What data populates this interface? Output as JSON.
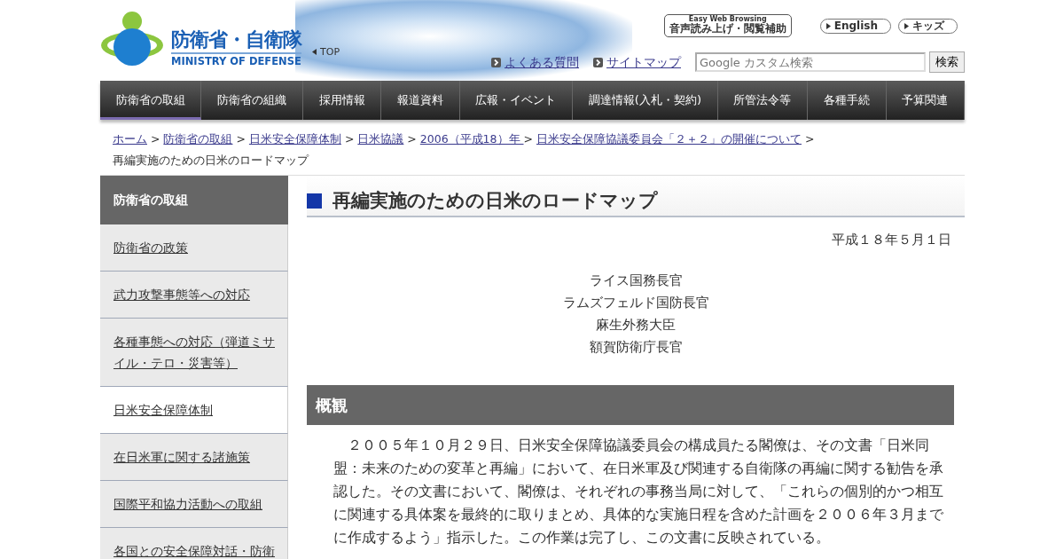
{
  "header": {
    "logo_title": "防衛省・自衛隊",
    "logo_subtitle": "MINISTRY OF DEFENSE",
    "top_link": "TOP",
    "accessibility": {
      "caption": "Easy Web Browsing",
      "label": "音声読み上げ・閲覧補助"
    },
    "language_links": [
      "English",
      "キッズ"
    ],
    "links": [
      "よくある質問",
      "サイトマップ"
    ],
    "search": {
      "placeholder": "Google カスタム検索",
      "button": "検索"
    }
  },
  "nav": [
    {
      "label": "防衛省の取組",
      "selected": true
    },
    {
      "label": "防衛省の組織",
      "selected": false
    },
    {
      "label": "採用情報",
      "selected": false
    },
    {
      "label": "報道資料",
      "selected": false
    },
    {
      "label": "広報・イベント",
      "selected": false
    },
    {
      "label": "調達情報(入札・契約)",
      "selected": false
    },
    {
      "label": "所管法令等",
      "selected": false
    },
    {
      "label": "各種手続",
      "selected": false
    },
    {
      "label": "予算関連",
      "selected": false
    }
  ],
  "breadcrumb": {
    "separator": ">",
    "items": [
      {
        "text": "ホーム",
        "link": true
      },
      {
        "text": "防衛省の取組",
        "link": true
      },
      {
        "text": "日米安全保障体制",
        "link": true
      },
      {
        "text": "日米協議",
        "link": true
      },
      {
        "text": "2006（平成18）年 ",
        "link": true
      },
      {
        "text": "日米安全保障協議委員会「２＋２」の開催について",
        "link": true
      },
      {
        "text": "再編実施のための日米のロードマップ",
        "link": false
      }
    ]
  },
  "sidebar": {
    "heading": "防衛省の取組",
    "items": [
      {
        "label": "防衛省の政策",
        "selected": false
      },
      {
        "label": "武力攻撃事態等への対応",
        "selected": false
      },
      {
        "label": "各種事態への対応（弾道ミサイル・テロ・災害等）",
        "selected": false
      },
      {
        "label": "日米安全保障体制",
        "selected": true
      },
      {
        "label": "在日米軍に関する諸施策",
        "selected": false
      },
      {
        "label": "国際平和協力活動への取組",
        "selected": false
      },
      {
        "label": "各国との安全保障対話・防衛",
        "selected": false
      }
    ]
  },
  "article": {
    "title": "再編実施のための日米のロードマップ",
    "date": "平成１８年５月１日",
    "signatories": [
      "ライス国務長官",
      "ラムズフェルド国防長官",
      "麻生外務大臣",
      "額賀防衛庁長官"
    ],
    "section_heading": "概観",
    "paragraph": "２００５年１０月２９日、日米安全保障協議委員会の構成員たる閣僚は、その文書「日米同盟：未来のための変革と再編」において、在日米軍及び関連する自衛隊の再編に関する勧告を承認した。その文書において、閣僚は、それぞれの事務当局に対して、「これらの個別的かつ相互に関連する具体案を最終的に取りまとめ、具体的な実施日程を含めた計画を２００６年３月までに作成するよう」指示した。この作業は完了し、この文書に反映されている。"
  }
}
